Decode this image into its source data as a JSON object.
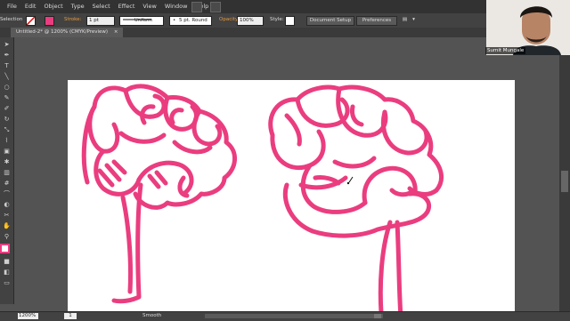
{
  "menubar": {
    "app_label": "Ai",
    "items": [
      "File",
      "Edit",
      "Object",
      "Type",
      "Select",
      "Effect",
      "View",
      "Window",
      "Help"
    ]
  },
  "control_bar": {
    "selection_label": "Selection",
    "stroke_label": "Stroke:",
    "stroke_weight": "1 pt",
    "uniform_label": "Uniform",
    "brush_label": "5 pt. Round",
    "opacity_label": "Opacity:",
    "opacity_value": "100%",
    "style_label": "Style:",
    "document_setup": "Document Setup",
    "preferences": "Preferences"
  },
  "document_tab": {
    "title": "Untitled-2* @ 1200% (CMYK/Preview)",
    "close": "×"
  },
  "webcam": {
    "name": "Sumit Mungale"
  },
  "status_bar": {
    "zoom": "1200%",
    "page": "1",
    "tool": "Smooth"
  },
  "colors": {
    "stroke_pink": "#ea3d7f",
    "ui_dark": "#323232",
    "ui_mid": "#424242",
    "pasteboard": "#535353",
    "artboard": "#ffffff"
  },
  "icons": {
    "selection": "arrow-icon",
    "brush": "brush-icon",
    "grid": "grid-icon"
  }
}
